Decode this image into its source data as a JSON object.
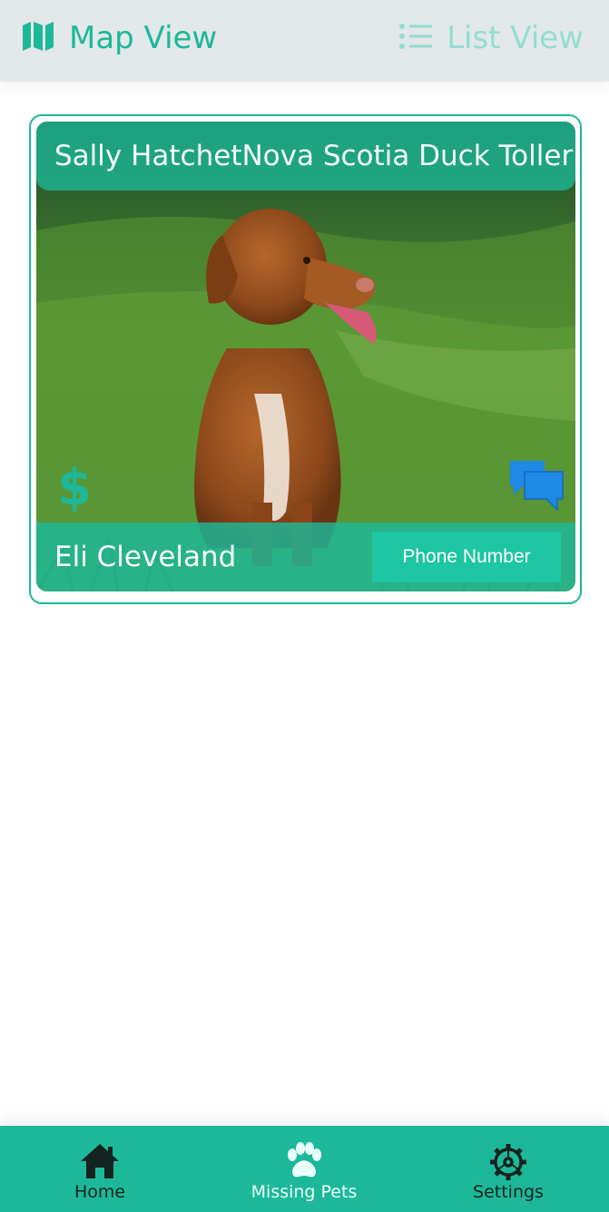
{
  "header": {
    "tabs": [
      {
        "label": "Map View",
        "icon": "map-icon",
        "active": true
      },
      {
        "label": "List View",
        "icon": "list-icon",
        "active": false
      }
    ]
  },
  "pet_card": {
    "pet_name": "Sally Hatchet",
    "breed": "Nova Scotia Duck Toller",
    "owner_name": "Eli Cleveland",
    "phone_button_label": "Phone Number",
    "reward_icon": "dollar-icon",
    "chat_icon": "chat-bubbles-icon",
    "photo": "dog-photo"
  },
  "bottom_nav": {
    "items": [
      {
        "label": "Home",
        "icon": "home-icon"
      },
      {
        "label": "Missing Pets",
        "icon": "paw-icon"
      },
      {
        "label": "Settings",
        "icon": "gear-icon"
      }
    ]
  },
  "colors": {
    "accent": "#1db899",
    "accent_light": "#93ddd0",
    "topbar_bg": "#e3e8ea",
    "chat_blue": "#1e88e5"
  }
}
